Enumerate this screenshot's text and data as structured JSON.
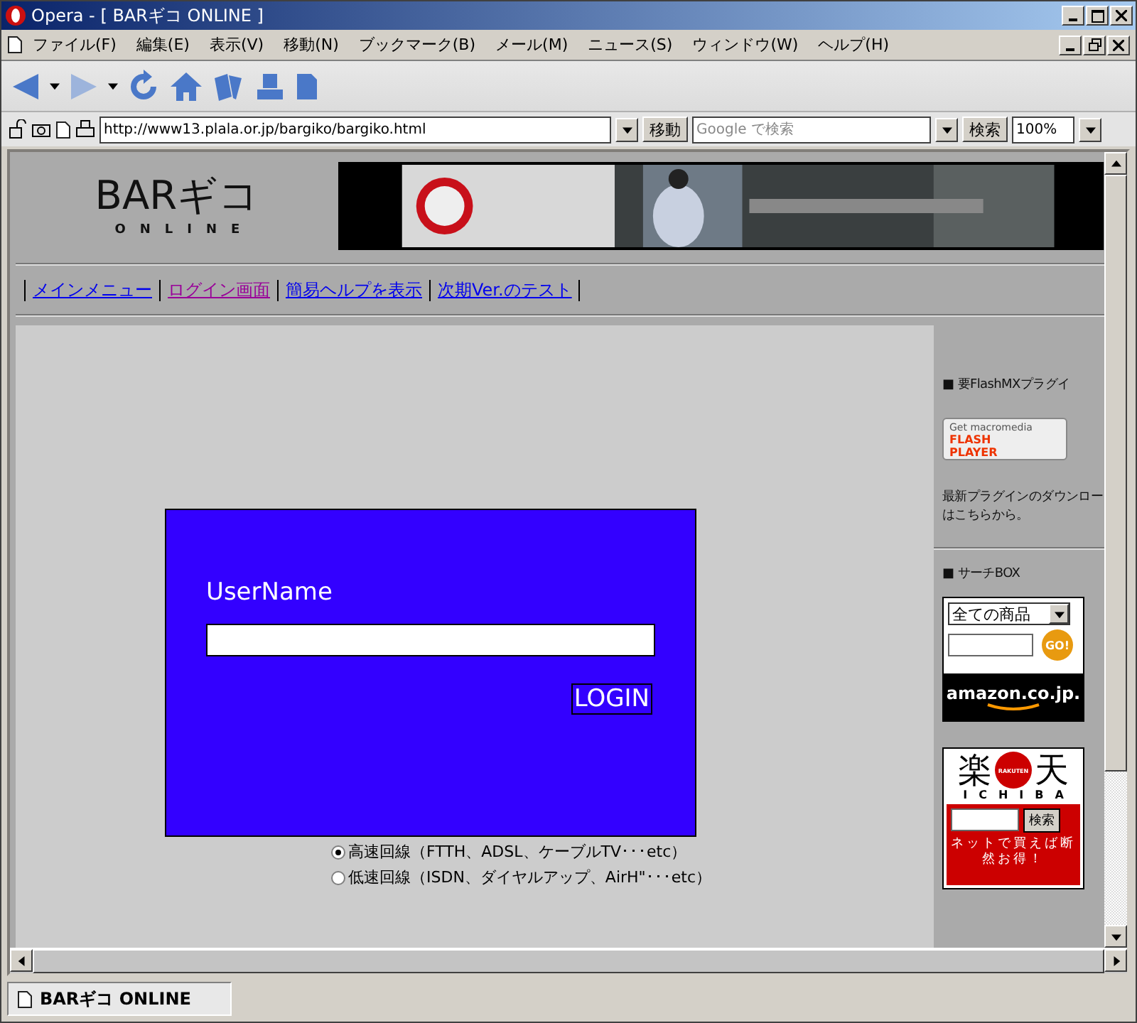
{
  "window": {
    "title": "Opera - [ BARギコ ONLINE ]",
    "menu": [
      "ファイル(F)",
      "編集(E)",
      "表示(V)",
      "移動(N)",
      "ブックマーク(B)",
      "メール(M)",
      "ニュース(S)",
      "ウィンドウ(W)",
      "ヘルプ(H)"
    ],
    "address": {
      "url": "http://www13.plala.or.jp/bargiko/bargiko.html",
      "go": "移動"
    },
    "search": {
      "placeholder": "Google で検索",
      "button": "検索"
    },
    "zoom": "100%"
  },
  "page": {
    "logo": {
      "title": "BARギコ",
      "subtitle": "ONLINE"
    },
    "nav": [
      {
        "label": "メインメニュー",
        "visited": false
      },
      {
        "label": "ログイン画面",
        "visited": true
      },
      {
        "label": "簡易ヘルプを表示",
        "visited": false
      },
      {
        "label": "次期Ver.のテスト",
        "visited": false
      }
    ],
    "login": {
      "label": "UserName",
      "button": "LOGIN"
    },
    "connection_options": [
      {
        "label": "高速回線（FTTH、ADSL、ケーブルTV･･･etc）",
        "selected": true
      },
      {
        "label": "低速回線（ISDN、ダイヤルアップ、AirH\"･･･etc）",
        "selected": false
      }
    ],
    "sidebar": {
      "flash_heading": "■ 要FlashMXプラグイ",
      "flash_badge": {
        "line1": "Get macromedia",
        "line2": "FLASH",
        "line3": "PLAYER"
      },
      "flash_note": [
        "最新プラグインのダウンロー",
        "はこちらから。"
      ],
      "search_heading": "■ サーチBOX",
      "amazon": {
        "category": "全ての商品",
        "go": "GO!",
        "logo": "amazon.co.jp."
      },
      "rakuten": {
        "chars": [
          "楽",
          "天"
        ],
        "badge": "RAKUTEN",
        "sub": "ICHIBA",
        "button": "検索",
        "slogan": "ネットで買えば断然お得！"
      }
    }
  },
  "status_tab": "BARギコ ONLINE"
}
